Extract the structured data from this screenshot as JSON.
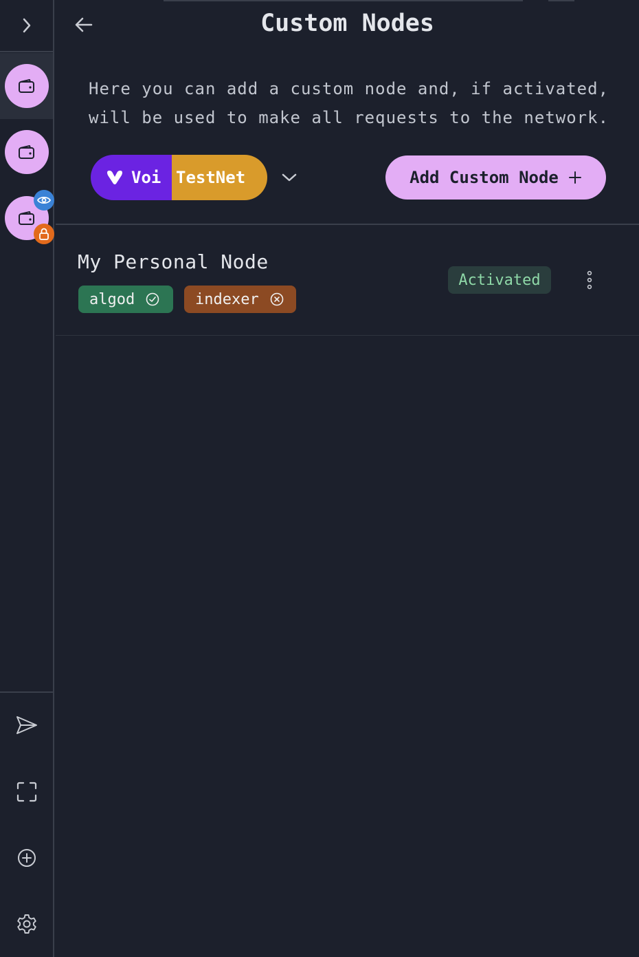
{
  "header": {
    "title": "Custom Nodes",
    "description": "Here you can add a custom node and, if activated, will be used to make all requests to the network."
  },
  "network": {
    "name": "Voi",
    "type": "TestNet",
    "name_color": "#6b23e2",
    "type_color": "#d99b2b"
  },
  "actions": {
    "add_custom_node_label": "Add Custom Node"
  },
  "sidebar": {
    "accounts": [
      {
        "icon": "wallet-icon",
        "active": true
      },
      {
        "icon": "wallet-icon",
        "active": false
      },
      {
        "icon": "wallet-icon",
        "active": false,
        "badges": [
          "eye-icon",
          "lock-icon"
        ]
      }
    ],
    "actions": [
      "send-icon",
      "scan-icon",
      "add-account-icon",
      "settings-icon"
    ]
  },
  "nodes": [
    {
      "name": "My Personal Node",
      "status": "Activated",
      "tags": [
        {
          "label": "algod",
          "state": "enabled",
          "icon": "check-circle-icon",
          "color": "#2c7553"
        },
        {
          "label": "indexer",
          "state": "disabled",
          "icon": "x-circle-icon",
          "color": "#8c4a23"
        }
      ]
    }
  ],
  "colors": {
    "accent": "#e3adf5",
    "background": "#1c202c",
    "activated_text": "#8fd9a8"
  }
}
